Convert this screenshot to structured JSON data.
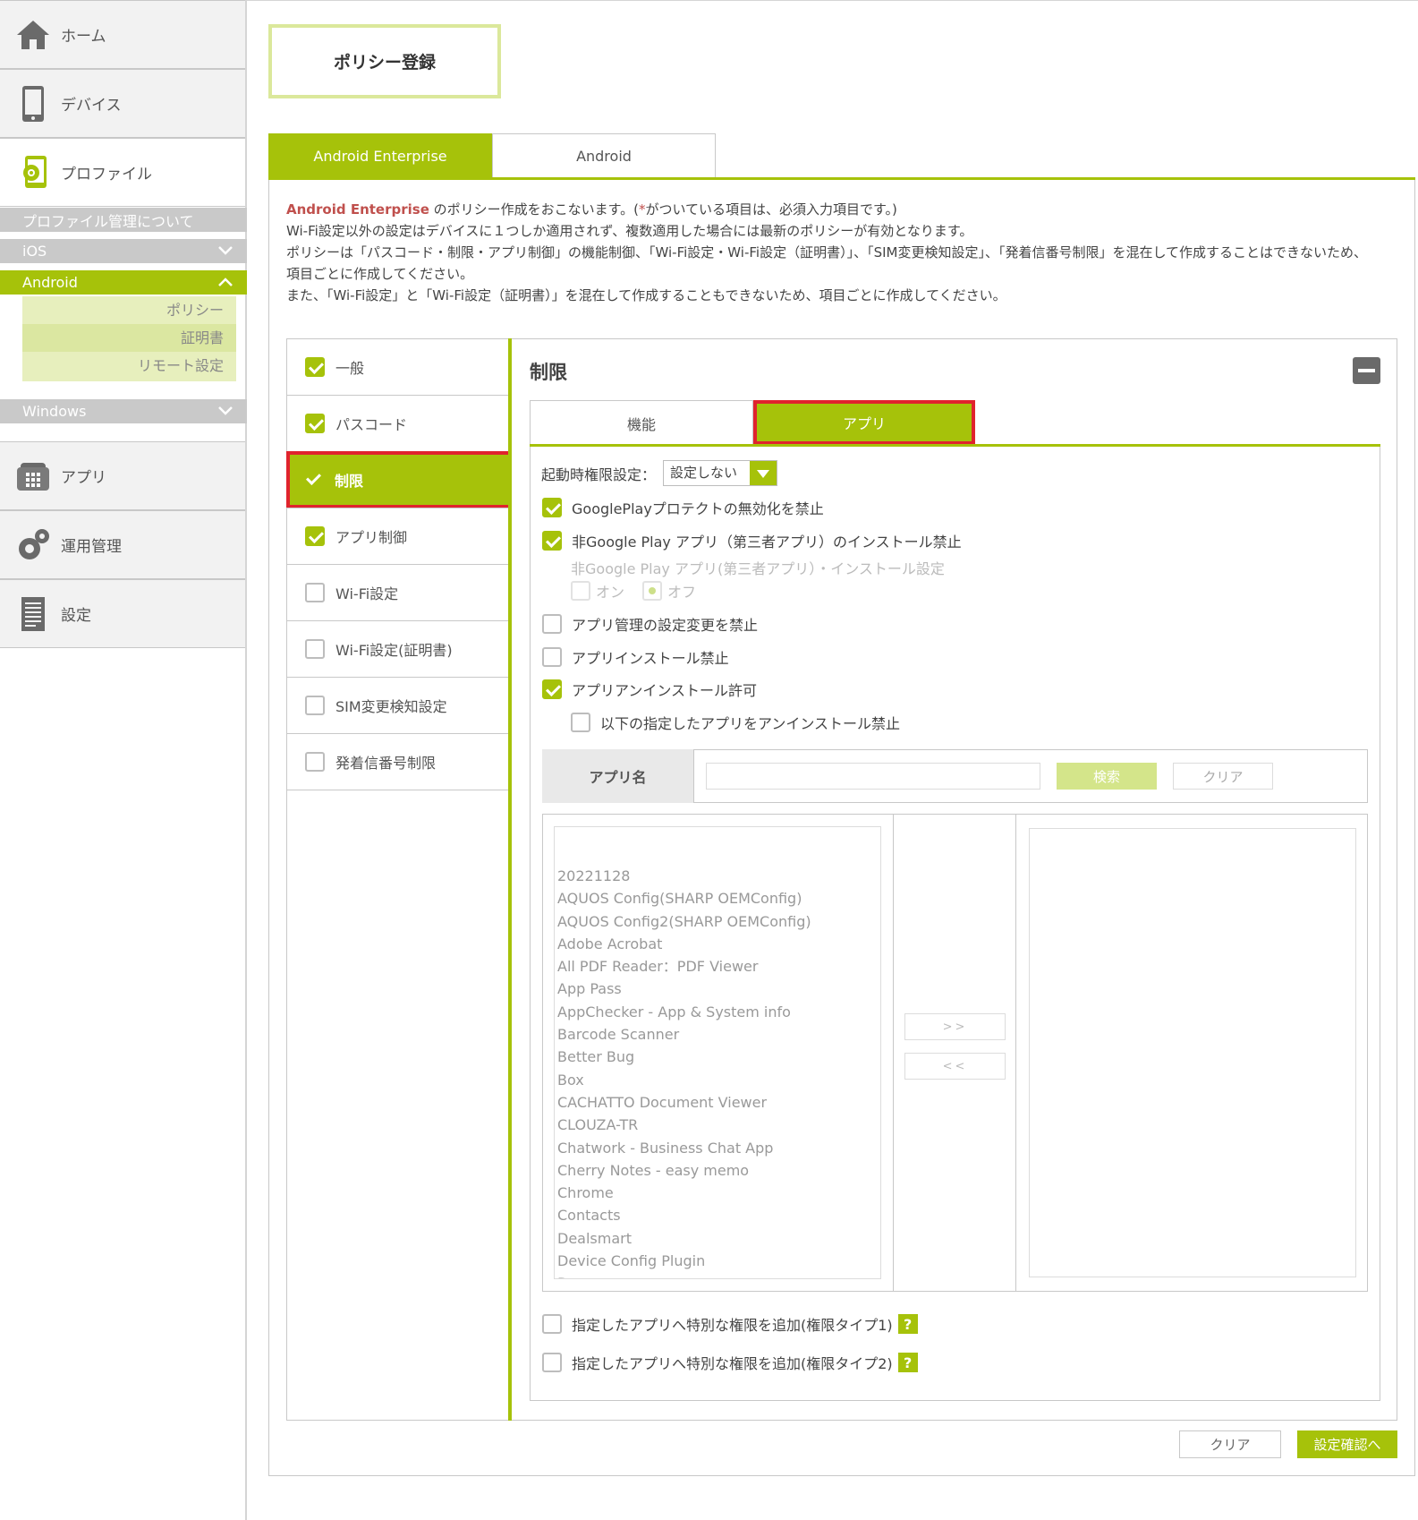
{
  "colors": {
    "accent": "#a6c20a",
    "highlight": "#e0232d",
    "sidebar_bg": "#f2f2f2"
  },
  "sidebar": {
    "home": "ホーム",
    "device": "デバイス",
    "profile": "プロファイル",
    "profile_about": "プロファイル管理について",
    "ios": "iOS",
    "android": "Android",
    "android_items": [
      "ポリシー",
      "証明書",
      "リモート設定"
    ],
    "windows": "Windows",
    "apps": "アプリ",
    "operations": "運用管理",
    "settings": "設定"
  },
  "page": {
    "title": "ポリシー登録",
    "tabs": [
      "Android Enterprise",
      "Android"
    ],
    "intro": {
      "brand": "Android Enterprise",
      "line1_rest": " のポリシー作成をおこないます。(",
      "star": "*",
      "line1_end": "がついている項目は、必須入力項目です。)",
      "line2": "Wi-Fi設定以外の設定はデバイスに１つしか適用されず、複数適用した場合には最新のポリシーが有効となります。",
      "line3": "ポリシーは「パスコード・制限・アプリ制御」の機能制御、「Wi-Fi設定・Wi-Fi設定（証明書）」、「SIM変更検知設定」、「発着信番号制限」を混在して作成することはできないため、",
      "line4": "項目ごとに作成してください。",
      "line5": "また、「Wi-Fi設定」と「Wi-Fi設定（証明書）」を混在して作成することもできないため、項目ごとに作成してください。"
    }
  },
  "categories": [
    {
      "label": "一般",
      "checked": true
    },
    {
      "label": "パスコード",
      "checked": true
    },
    {
      "label": "制限",
      "checked": true
    },
    {
      "label": "アプリ制御",
      "checked": true
    },
    {
      "label": "Wi-Fi設定",
      "checked": false
    },
    {
      "label": "Wi-Fi設定(証明書)",
      "checked": false
    },
    {
      "label": "SIM変更検知設定",
      "checked": false
    },
    {
      "label": "発着信番号制限",
      "checked": false
    }
  ],
  "restriction": {
    "title": "制限",
    "subtabs": [
      "機能",
      "アプリ"
    ],
    "perm_label": "起動時権限設定：",
    "perm_value": "設定しない",
    "options": {
      "gp_protect": "GooglePlayプロテクトの無効化を禁止",
      "non_gp_install": "非Google Play アプリ（第三者アプリ）のインストール禁止",
      "non_gp_setting": "非Google Play アプリ(第三者アプリ）・インストール設定",
      "on": "オン",
      "off": "オフ",
      "app_mgmt": "アプリ管理の設定変更を禁止",
      "app_install": "アプリインストール禁止",
      "app_uninstall": "アプリアンインストール許可",
      "uninstall_block": "以下の指定したアプリをアンインストール禁止",
      "perm_type1": "指定したアプリへ特別な権限を追加(権限タイプ1)",
      "perm_type2": "指定したアプリへ特別な権限を追加(権限タイプ2)"
    },
    "search": {
      "label": "アプリ名",
      "value": "",
      "search_btn": "検索",
      "clear_btn": "クリア"
    },
    "app_list": [
      "20221128",
      "AQUOS Config(SHARP OEMConfig)",
      "AQUOS Config2(SHARP OEMConfig)",
      "Adobe Acrobat",
      "All PDF Reader：PDF Viewer",
      "App Pass",
      "AppChecker - App & System info",
      "Barcode Scanner",
      "Better Bug",
      "Box",
      "CACHATTO Document Viewer",
      "CLOUZA-TR",
      "Chatwork - Business Chat App",
      "Cherry Notes - easy memo",
      "Chrome",
      "Contacts",
      "Dealsmart",
      "Device Config Plugin",
      "Duo"
    ],
    "move_right": ">>",
    "move_left": "<<",
    "help": "?"
  },
  "footer": {
    "clear": "クリア",
    "confirm": "設定確認へ"
  }
}
